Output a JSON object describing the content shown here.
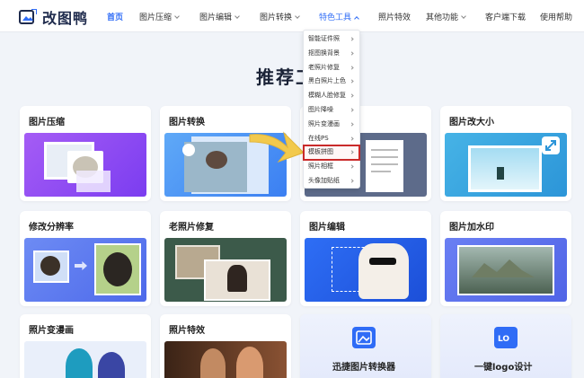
{
  "brand": {
    "name": "改图鸭"
  },
  "nav": {
    "items": [
      {
        "label": "首页"
      },
      {
        "label": "图片压缩"
      },
      {
        "label": "图片编辑"
      },
      {
        "label": "图片转换"
      },
      {
        "label": "特色工具"
      },
      {
        "label": "照片特效"
      },
      {
        "label": "其他功能"
      },
      {
        "label": "客户端下载"
      },
      {
        "label": "使用帮助"
      }
    ],
    "active_index": 0,
    "open_menu_index": 4
  },
  "headline": "推荐工",
  "dropdown": {
    "items": [
      {
        "label": "智能证件照"
      },
      {
        "label": "抠图换背景"
      },
      {
        "label": "老照片修复"
      },
      {
        "label": "黑白照片上色"
      },
      {
        "label": "模糊人脸修复"
      },
      {
        "label": "图片降噪"
      },
      {
        "label": "照片变漫画"
      },
      {
        "label": "在线PS"
      },
      {
        "label": "模板拼图"
      },
      {
        "label": "照片相框"
      },
      {
        "label": "头像加贴纸"
      }
    ],
    "highlighted_index": 8
  },
  "cards": [
    {
      "title": "图片压缩"
    },
    {
      "title": "图片转换"
    },
    {
      "title": ""
    },
    {
      "title": "图片改大小"
    },
    {
      "title": "修改分辨率"
    },
    {
      "title": "老照片修复"
    },
    {
      "title": "图片编辑"
    },
    {
      "title": "图片加水印"
    },
    {
      "title": "照片变漫画"
    },
    {
      "title": "照片特效"
    },
    {
      "title": "迅捷图片转换器"
    },
    {
      "title": "一键logo设计"
    }
  ],
  "colors": {
    "accent": "#2f6cf6",
    "highlight_border": "#c92a2a",
    "pointer_arrow": "#f2c94c"
  }
}
